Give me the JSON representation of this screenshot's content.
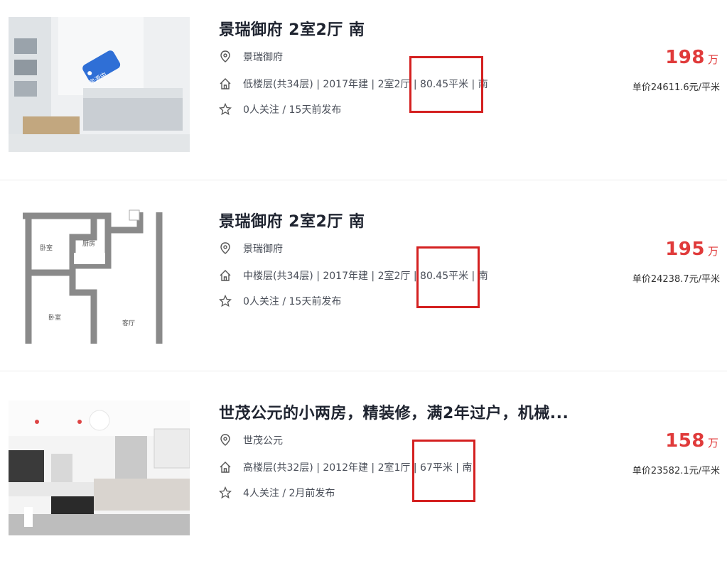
{
  "listings": [
    {
      "title": "景瑞御府 2室2厅 南",
      "community": "景瑞御府",
      "details": "低楼层(共34层) | 2017年建 | 2室2厅 | 80.45平米 | 南",
      "follow": "0人关注 / 15天前发布",
      "price": "198",
      "price_unit": "万",
      "unit_price": "单价24611.6元/平米",
      "tag": "房源中"
    },
    {
      "title": "景瑞御府 2室2厅 南",
      "community": "景瑞御府",
      "details": "中楼层(共34层) | 2017年建 | 2室2厅 | 80.45平米 | 南",
      "follow": "0人关注 / 15天前发布",
      "price": "195",
      "price_unit": "万",
      "unit_price": "单价24238.7元/平米",
      "floorplan": {
        "room_a": "卧室",
        "room_b": "厨房",
        "room_c": "卧室",
        "room_d": "客厅"
      }
    },
    {
      "title": "世茂公元的小两房，精装修，满2年过户，机械...",
      "community": "世茂公元",
      "details": "高楼层(共32层) | 2012年建 | 2室1厅 | 67平米 | 南",
      "follow": "4人关注 / 2月前发布",
      "price": "158",
      "price_unit": "万",
      "unit_price": "单价23582.1元/平米"
    }
  ],
  "colors": {
    "price": "#e03a3a",
    "highlight_box": "#d42020",
    "title": "#1f2430"
  },
  "icons": [
    "location-pin-icon",
    "house-icon",
    "star-icon"
  ]
}
